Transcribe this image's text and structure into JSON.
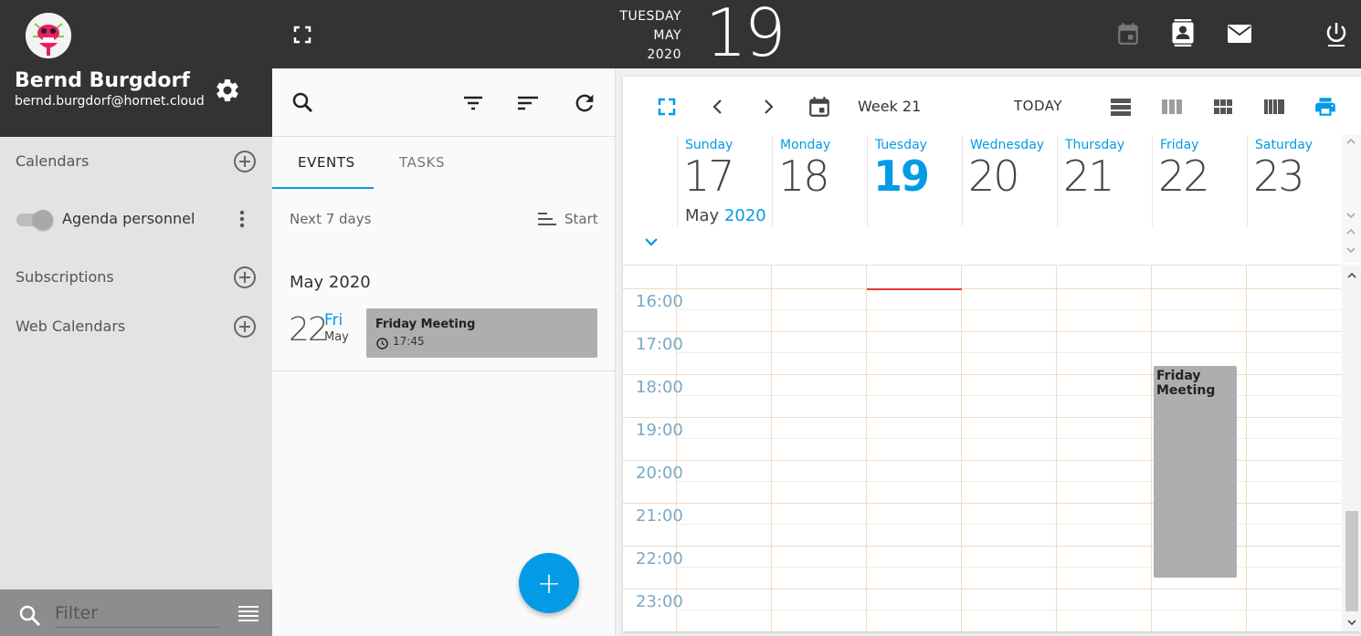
{
  "header": {
    "weekday": "TUESDAY",
    "month": "MAY",
    "year": "2020",
    "day": "19",
    "icons": [
      "fullscreen-icon",
      "calendar-icon",
      "contacts-icon",
      "mail-icon",
      "power-icon"
    ]
  },
  "profile": {
    "name": "Bernd Burgdorf",
    "email": "bernd.burgdorf@hornet.cloud"
  },
  "sidebar": {
    "calendars_label": "Calendars",
    "calendar_items": [
      {
        "name": "Agenda personnel",
        "enabled": true
      }
    ],
    "subscriptions_label": "Subscriptions",
    "web_calendars_label": "Web Calendars",
    "filter_placeholder": "Filter"
  },
  "middle": {
    "tabs": [
      {
        "label": "EVENTS",
        "active": true
      },
      {
        "label": "TASKS",
        "active": false
      }
    ],
    "range_label": "Next 7 days",
    "sort_label": "Start",
    "month_header": "May 2020",
    "events": [
      {
        "day_number": "22",
        "day_name": "Fri",
        "month": "May",
        "title": "Friday Meeting",
        "time": "17:45"
      }
    ],
    "fab_label": "+"
  },
  "calendar": {
    "week_label": "Week 21",
    "today_label": "TODAY",
    "month_label": "May",
    "year_label": "2020",
    "days": [
      {
        "name": "Sunday",
        "number": "17",
        "today": false
      },
      {
        "name": "Monday",
        "number": "18",
        "today": false
      },
      {
        "name": "Tuesday",
        "number": "19",
        "today": true
      },
      {
        "name": "Wednesday",
        "number": "20",
        "today": false
      },
      {
        "name": "Thursday",
        "number": "21",
        "today": false
      },
      {
        "name": "Friday",
        "number": "22",
        "today": false
      },
      {
        "name": "Saturday",
        "number": "23",
        "today": false
      }
    ],
    "hours": [
      "16:00",
      "17:00",
      "18:00",
      "19:00",
      "20:00",
      "21:00",
      "22:00",
      "23:00"
    ],
    "grid_event": {
      "title": "Friday Meeting",
      "day": "Friday"
    }
  },
  "colors": {
    "accent": "#039be5",
    "topbar": "#333333",
    "sidebar": "#e3e3e3",
    "event": "#aeaeae",
    "now_line": "#e53935"
  }
}
